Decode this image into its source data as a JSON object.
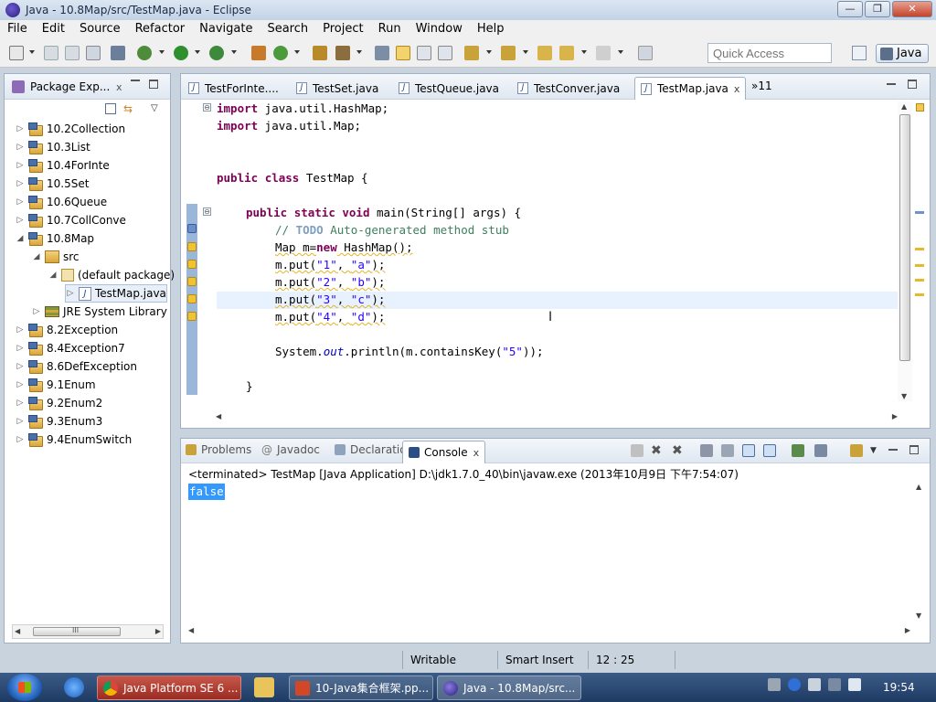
{
  "window": {
    "title": "Java - 10.8Map/src/TestMap.java - Eclipse",
    "minimize": "—",
    "maximize": "❐",
    "close": "✕"
  },
  "menu": [
    "File",
    "Edit",
    "Source",
    "Refactor",
    "Navigate",
    "Search",
    "Project",
    "Run",
    "Window",
    "Help"
  ],
  "toolbar": {
    "quick_access_placeholder": "Quick Access",
    "perspective": "Java"
  },
  "package_explorer": {
    "title": "Package Exp...",
    "tree": [
      {
        "label": "10.2Collection",
        "twisty": "▷",
        "icon": "project"
      },
      {
        "label": "10.3List",
        "twisty": "▷",
        "icon": "project"
      },
      {
        "label": "10.4ForInte",
        "twisty": "▷",
        "icon": "project"
      },
      {
        "label": "10.5Set",
        "twisty": "▷",
        "icon": "project"
      },
      {
        "label": "10.6Queue",
        "twisty": "▷",
        "icon": "project"
      },
      {
        "label": "10.7CollConve",
        "twisty": "▷",
        "icon": "project"
      },
      {
        "label": "10.8Map",
        "twisty": "◢",
        "icon": "project"
      },
      {
        "label": "src",
        "twisty": "◢",
        "icon": "source-folder"
      },
      {
        "label": "(default package)",
        "twisty": "◢",
        "icon": "package"
      },
      {
        "label": "TestMap.java",
        "twisty": "▷",
        "icon": "java-file",
        "selected": true
      },
      {
        "label": "JRE System Library",
        "twisty": "▷",
        "icon": "library"
      },
      {
        "label": "8.2Exception",
        "twisty": "▷",
        "icon": "project"
      },
      {
        "label": "8.4Exception7",
        "twisty": "▷",
        "icon": "project"
      },
      {
        "label": "8.6DefException",
        "twisty": "▷",
        "icon": "project"
      },
      {
        "label": "9.1Enum",
        "twisty": "▷",
        "icon": "project"
      },
      {
        "label": "9.2Enum2",
        "twisty": "▷",
        "icon": "project"
      },
      {
        "label": "9.3Enum3",
        "twisty": "▷",
        "icon": "project"
      },
      {
        "label": "9.4EnumSwitch",
        "twisty": "▷",
        "icon": "project"
      }
    ],
    "scroll_thumb_label": "III"
  },
  "editor": {
    "tabs": [
      {
        "label": "TestForInte...."
      },
      {
        "label": "TestSet.java"
      },
      {
        "label": "TestQueue.java"
      },
      {
        "label": "TestConver.java"
      },
      {
        "label": "TestMap.java",
        "active": true
      }
    ],
    "tab_overflow": "»11",
    "code": {
      "l1_kw": "import",
      "l1_rest": " java.util.HashMap;",
      "l2_kw": "import",
      "l2_rest": " java.util.Map;",
      "l3_kw1": "public",
      "l3_kw2": "class",
      "l3_rest": " TestMap {",
      "l4_kw1": "public",
      "l4_kw2": "static",
      "l4_kw3": "void",
      "l4_rest": " main(String[] args) {",
      "l5_cmt1": "// ",
      "l5_todo": "TODO",
      "l5_cmt2": " Auto-generated method stub",
      "l6_a": "Map m=",
      "l6_kw": "new",
      "l6_b": " HashMap();",
      "put_open": "m.put(",
      "put_sep": ", ",
      "put_close": ");",
      "puts": [
        [
          "\"1\"",
          "\"a\""
        ],
        [
          "\"2\"",
          "\"b\""
        ],
        [
          "\"3\"",
          "\"c\""
        ],
        [
          "\"4\"",
          "\"d\""
        ]
      ],
      "l11_a": "System.",
      "l11_fld": "out",
      "l11_b": ".println(m.containsKey(",
      "l11_str": "\"5\"",
      "l11_c": "));",
      "l12": "}"
    },
    "fold_symbol": "⊖"
  },
  "console": {
    "tabs": [
      {
        "label": "Problems"
      },
      {
        "label": "Javadoc"
      },
      {
        "label": "Declaration"
      },
      {
        "label": "Console",
        "active": true
      }
    ],
    "status": "<terminated> TestMap [Java Application] D:\\jdk1.7.0_40\\bin\\javaw.exe (2013年10月9日 下午7:54:07)",
    "output": "false"
  },
  "statusbar": {
    "mode": "Writable",
    "insert": "Smart Insert",
    "position": "12 : 25"
  },
  "taskbar": {
    "apps": [
      {
        "label": "Java Platform SE 6 ..."
      },
      {
        "label": "10-Java集合框架.pp..."
      },
      {
        "label": "Java - 10.8Map/src..."
      }
    ],
    "clock": "19:54"
  }
}
